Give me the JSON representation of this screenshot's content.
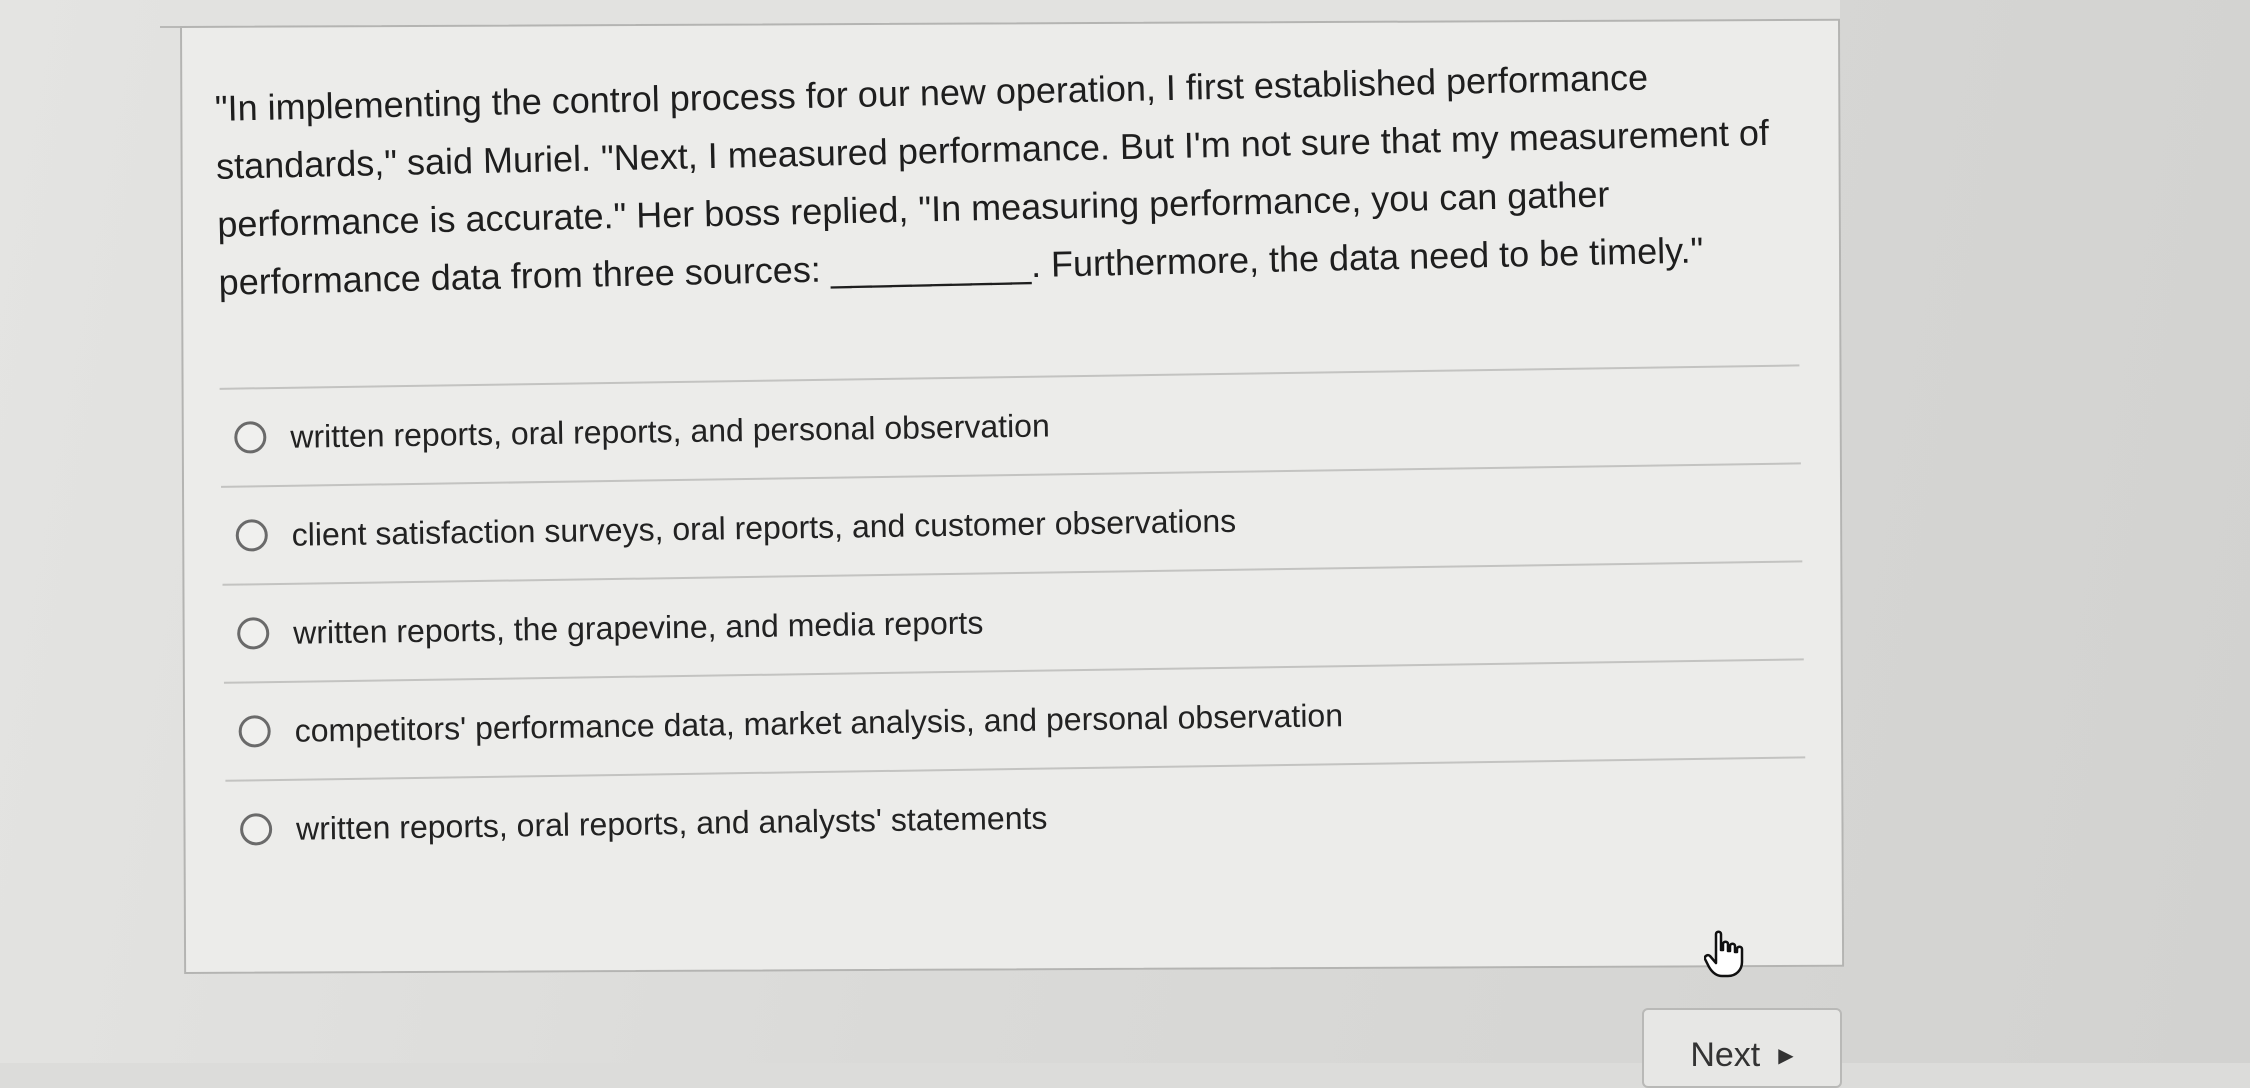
{
  "question": {
    "text": "\"In implementing the control process for our new operation, I first established performance standards,\" said Muriel. \"Next, I measured performance. But I'm not sure that my measurement of performance is accurate.\" Her boss replied, \"In measuring performance, you can gather performance data from three sources: __________. Furthermore, the data need to be timely.\""
  },
  "options": [
    {
      "label": "written reports, oral reports, and personal observation"
    },
    {
      "label": "client satisfaction surveys, oral reports, and customer observations"
    },
    {
      "label": "written reports, the grapevine, and media reports"
    },
    {
      "label": "competitors' performance data, market analysis, and personal observation"
    },
    {
      "label": "written reports, oral reports, and analysts' statements"
    }
  ],
  "navigation": {
    "next_label": "Next",
    "next_icon": "triangle-right-icon"
  },
  "cursor": {
    "icon": "hand-pointer-icon"
  }
}
